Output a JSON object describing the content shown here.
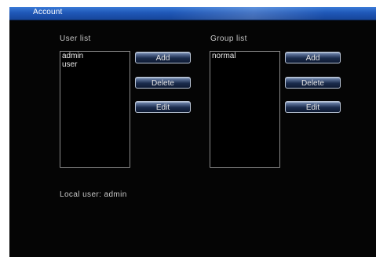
{
  "window": {
    "title": "Account"
  },
  "users": {
    "label": "User list",
    "items": [
      "admin",
      "user"
    ],
    "buttons": {
      "add": "Add",
      "delete": "Delete",
      "edit": "Edit"
    }
  },
  "groups": {
    "label": "Group list",
    "items": [
      "normal"
    ],
    "buttons": {
      "add": "Add",
      "delete": "Delete",
      "edit": "Edit"
    }
  },
  "status": {
    "local_user": "Local user: admin"
  },
  "colors": {
    "titlebar": "#1f58b8",
    "background": "#050505",
    "text": "#c8c8c8"
  }
}
